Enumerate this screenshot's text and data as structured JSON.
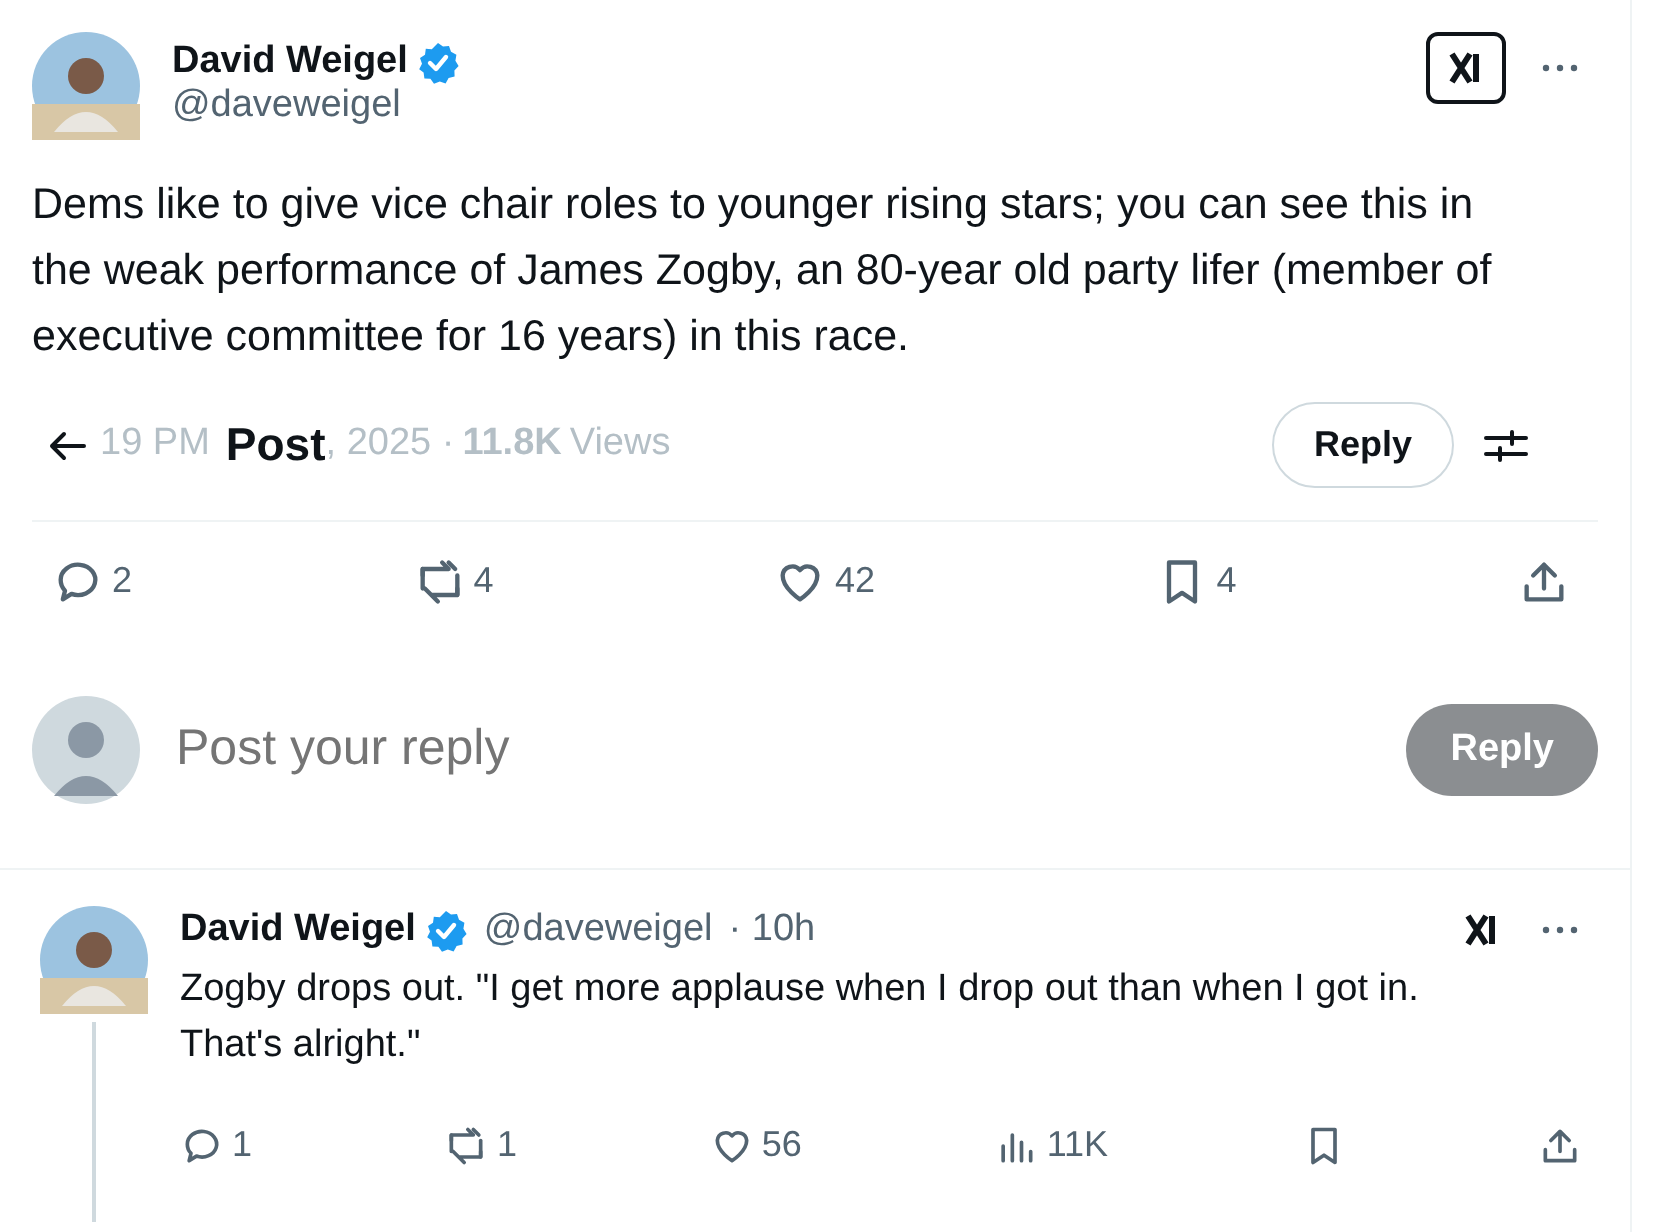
{
  "post": {
    "author": {
      "name": "David Weigel",
      "verified": true,
      "handle": "@daveweigel"
    },
    "text": "Dems like to give vice chair roles to younger rising stars; you can see this in the weak performance of James Zogby, an 80-year old party lifer (member of executive committee for 16 years) in this race.",
    "meta": {
      "time": "19 PM",
      "date": ", 2025 ·",
      "views_count": "11.8K",
      "views_label": "Views"
    },
    "actions": [
      {
        "kind": "reply",
        "count": "2"
      },
      {
        "kind": "repost",
        "count": "4"
      },
      {
        "kind": "like",
        "count": "42"
      },
      {
        "kind": "bookmark",
        "count": "4"
      },
      {
        "kind": "share"
      }
    ]
  },
  "header": {
    "title": "Post",
    "reply_button": "Reply"
  },
  "composer": {
    "placeholder": "Post your reply",
    "button": "Reply",
    "disabled": true
  },
  "replies": [
    {
      "author": {
        "name": "David Weigel",
        "verified": true,
        "handle": "@daveweigel",
        "time": "· 10h"
      },
      "text": "Zogby drops out. \"I get more applause when I drop out than when I got in. That's alright.\"",
      "thread_line": true,
      "actions": [
        {
          "kind": "reply",
          "count": "1"
        },
        {
          "kind": "repost",
          "count": "1"
        },
        {
          "kind": "like",
          "count": "56"
        },
        {
          "kind": "views",
          "count": "11K"
        },
        {
          "kind": "bookmark"
        },
        {
          "kind": "share"
        }
      ]
    }
  ]
}
